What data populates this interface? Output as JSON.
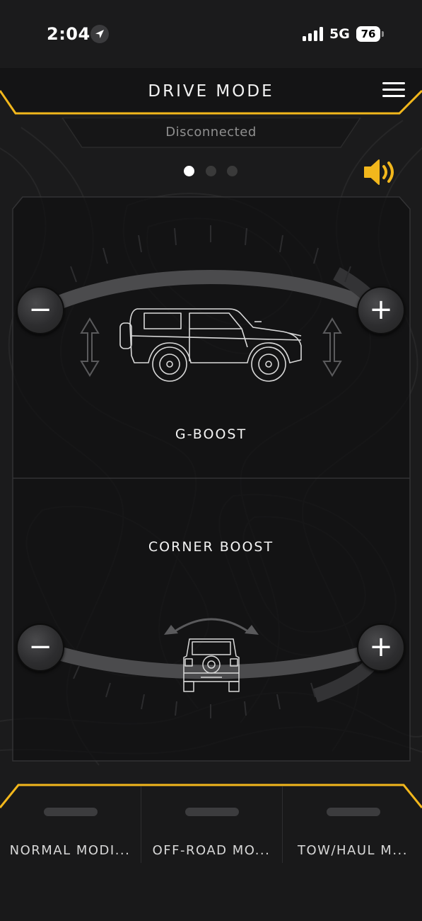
{
  "status_bar": {
    "time": "2:04",
    "location_icon": "location-arrow-icon",
    "signal_icon": "cellular-signal-icon",
    "network": "5G",
    "battery_level": "76"
  },
  "header": {
    "title": "DRIVE MODE",
    "menu_icon": "hamburger-menu-icon",
    "accent_color": "#f2b71c"
  },
  "connection": {
    "status": "Disconnected"
  },
  "pager": {
    "pages": 3,
    "active_index": 0
  },
  "sound": {
    "icon": "speaker-volume-icon",
    "color": "#f2b71c"
  },
  "g_boost": {
    "label": "G-BOOST",
    "decrease_label": "−",
    "increase_label": "+",
    "vehicle_icon": "suv-side-view-icon",
    "height_icon": "up-down-arrow-icon"
  },
  "corner_boost": {
    "label": "CORNER BOOST",
    "decrease_label": "−",
    "increase_label": "+",
    "vehicle_icon": "suv-rear-view-icon",
    "turn_icon": "curved-double-arrow-icon"
  },
  "modes": [
    {
      "label": "NORMAL MODI..."
    },
    {
      "label": "OFF-ROAD MO..."
    },
    {
      "label": "TOW/HAUL M..."
    }
  ]
}
